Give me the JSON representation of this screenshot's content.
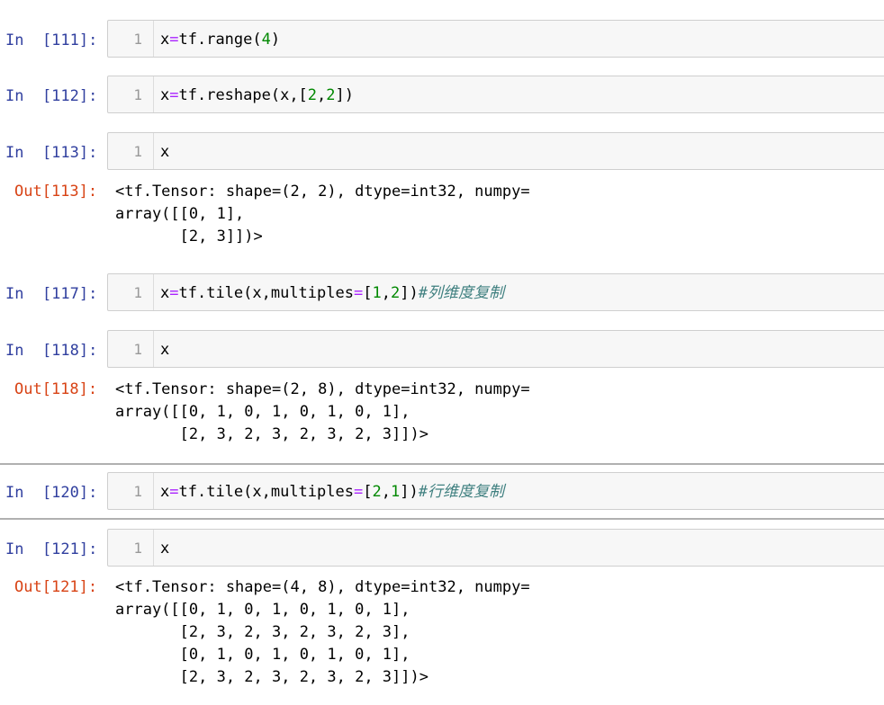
{
  "cells": [
    {
      "prompt": "In  [111]:",
      "code_parts": [
        [
          "x",
          ""
        ],
        [
          "=",
          "op"
        ],
        [
          "tf.range(",
          ""
        ],
        [
          "4",
          "num"
        ],
        [
          ")",
          ""
        ]
      ]
    },
    {
      "prompt": "In  [112]:",
      "code_parts": [
        [
          "x",
          ""
        ],
        [
          "=",
          "op"
        ],
        [
          "tf.reshape(x,[",
          ""
        ],
        [
          "2",
          "num"
        ],
        [
          ",",
          ""
        ],
        [
          "2",
          "num"
        ],
        [
          "])",
          ""
        ]
      ]
    },
    {
      "prompt": "In  [113]:",
      "code_parts": [
        [
          "x",
          ""
        ]
      ]
    },
    {
      "prompt": "In  [117]:",
      "code_parts": [
        [
          "x",
          ""
        ],
        [
          "=",
          "op"
        ],
        [
          "tf.tile(x,multiples",
          ""
        ],
        [
          "=",
          "op"
        ],
        [
          "[",
          ""
        ],
        [
          "1",
          "num"
        ],
        [
          ",",
          ""
        ],
        [
          "2",
          "num"
        ],
        [
          "])",
          ""
        ],
        [
          "#列维度复制",
          "comment"
        ]
      ]
    },
    {
      "prompt": "In  [118]:",
      "code_parts": [
        [
          "x",
          ""
        ]
      ]
    },
    {
      "prompt": "In  [120]:",
      "code_parts": [
        [
          "x",
          ""
        ],
        [
          "=",
          "op"
        ],
        [
          "tf.tile(x,multiples",
          ""
        ],
        [
          "=",
          "op"
        ],
        [
          "[",
          ""
        ],
        [
          "2",
          "num"
        ],
        [
          ",",
          ""
        ],
        [
          "1",
          "num"
        ],
        [
          "])",
          ""
        ],
        [
          "#行维度复制",
          "comment"
        ]
      ]
    },
    {
      "prompt": "In  [121]:",
      "code_parts": [
        [
          "x",
          ""
        ]
      ]
    }
  ],
  "line_number": "1",
  "outputs": [
    {
      "prompt": "Out[113]:",
      "text": "<tf.Tensor: shape=(2, 2), dtype=int32, numpy=\narray([[0, 1],\n       [2, 3]])>"
    },
    {
      "prompt": "Out[118]:",
      "text": "<tf.Tensor: shape=(2, 8), dtype=int32, numpy=\narray([[0, 1, 0, 1, 0, 1, 0, 1],\n       [2, 3, 2, 3, 2, 3, 2, 3]])>"
    },
    {
      "prompt": "Out[121]:",
      "text": "<tf.Tensor: shape=(4, 8), dtype=int32, numpy=\narray([[0, 1, 0, 1, 0, 1, 0, 1],\n       [2, 3, 2, 3, 2, 3, 2, 3],\n       [0, 1, 0, 1, 0, 1, 0, 1],\n       [2, 3, 2, 3, 2, 3, 2, 3]])>"
    }
  ]
}
